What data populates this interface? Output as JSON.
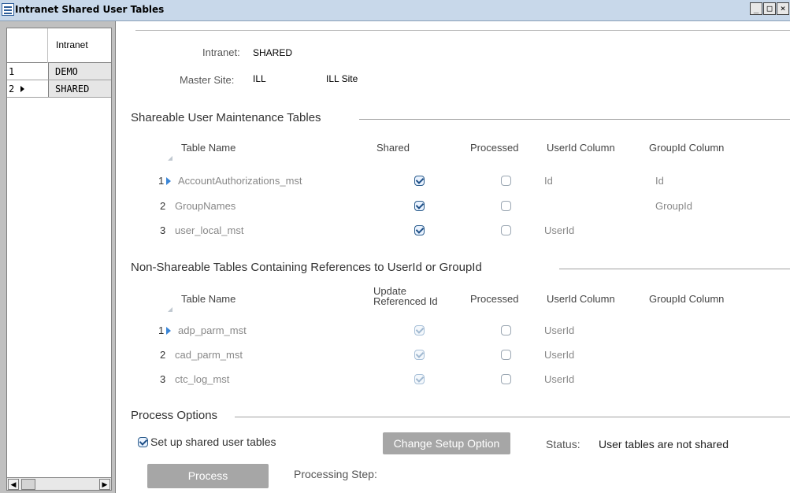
{
  "window": {
    "title": "Intranet Shared User Tables",
    "buttons": {
      "minimize": "_",
      "maximize": "□",
      "close": "×"
    }
  },
  "sidebar": {
    "column_header": "Intranet",
    "rows": [
      {
        "num": "1",
        "value": "DEMO",
        "current": false
      },
      {
        "num": "2",
        "value": "SHARED",
        "current": true
      }
    ]
  },
  "header": {
    "intranet_label": "Intranet:",
    "intranet_value": "SHARED",
    "master_site_label": "Master Site:",
    "master_site_code": "ILL",
    "master_site_name": "ILL Site"
  },
  "shareable": {
    "title": "Shareable User Maintenance Tables",
    "columns": [
      "Table Name",
      "Shared",
      "Processed",
      "UserId Column",
      "GroupId Column"
    ],
    "rows": [
      {
        "num": "1",
        "current": true,
        "name": "AccountAuthorizations_mst",
        "shared": true,
        "processed": false,
        "userid_col": "Id",
        "groupid_col": "Id"
      },
      {
        "num": "2",
        "current": false,
        "name": "GroupNames",
        "shared": true,
        "processed": false,
        "userid_col": "",
        "groupid_col": "GroupId"
      },
      {
        "num": "3",
        "current": false,
        "name": "user_local_mst",
        "shared": true,
        "processed": false,
        "userid_col": "UserId",
        "groupid_col": ""
      }
    ]
  },
  "nonshareable": {
    "title": "Non-Shareable Tables Containing References to UserId or GroupId",
    "columns": [
      "Table Name",
      "Update Referenced Id",
      "Processed",
      "UserId Column",
      "GroupId Column"
    ],
    "rows": [
      {
        "num": "1",
        "current": true,
        "name": "adp_parm_mst",
        "update": true,
        "processed": false,
        "userid_col": "UserId",
        "groupid_col": ""
      },
      {
        "num": "2",
        "current": false,
        "name": "cad_parm_mst",
        "update": true,
        "processed": false,
        "userid_col": "UserId",
        "groupid_col": ""
      },
      {
        "num": "3",
        "current": false,
        "name": "ctc_log_mst",
        "update": true,
        "processed": false,
        "userid_col": "UserId",
        "groupid_col": ""
      }
    ]
  },
  "process": {
    "title": "Process Options",
    "setup_checkbox_label": "Set up shared user tables",
    "setup_checked": true,
    "change_button": "Change Setup Option",
    "status_label": "Status:",
    "status_value": "User tables are not shared",
    "process_button": "Process",
    "step_label": "Processing Step:"
  }
}
